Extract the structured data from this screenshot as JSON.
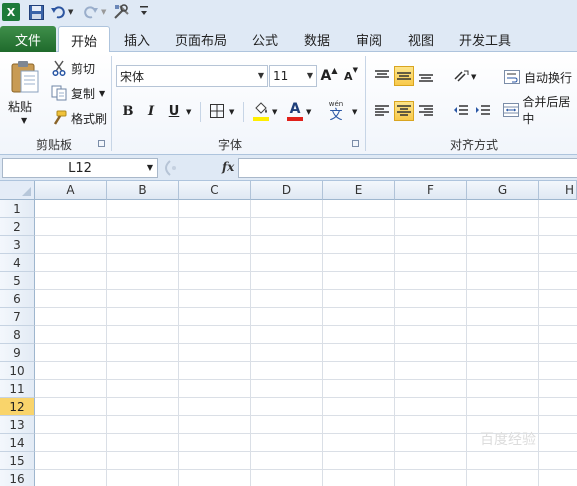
{
  "quick_access": {
    "app_icon": "X",
    "icons": [
      "excel-logo-icon",
      "save-icon",
      "undo-icon",
      "redo-icon",
      "customize-tools-icon",
      "qat-more-icon"
    ]
  },
  "tabs": {
    "file": "文件",
    "items": [
      "开始",
      "插入",
      "页面布局",
      "公式",
      "数据",
      "审阅",
      "视图",
      "开发工具"
    ],
    "active": "开始"
  },
  "clipboard": {
    "paste": "粘贴",
    "cut": "剪切",
    "copy": "复制",
    "format_painter": "格式刷",
    "group_label": "剪贴板"
  },
  "font": {
    "name": "宋体",
    "size": "11",
    "grow": "A",
    "shrink": "A",
    "bold": "B",
    "italic": "I",
    "underline": "U",
    "font_color_glyph": "A",
    "phonetic_top": "wén",
    "phonetic_bottom": "文",
    "group_label": "字体",
    "colors": {
      "fill": "#ffee00",
      "font": "#e0201a"
    }
  },
  "alignment": {
    "wrap_text": "自动换行",
    "merge_center": "合并后居中",
    "group_label": "对齐方式"
  },
  "formula_bar": {
    "name_box": "L12",
    "fx": "fx",
    "formula": ""
  },
  "sheet": {
    "columns": [
      "A",
      "B",
      "C",
      "D",
      "E",
      "F",
      "G",
      "H"
    ],
    "rows": [
      "1",
      "2",
      "3",
      "4",
      "5",
      "6",
      "7",
      "8",
      "9",
      "10",
      "11",
      "12",
      "13",
      "14",
      "15",
      "16"
    ],
    "active_row": "12"
  },
  "watermark": "百度经验"
}
